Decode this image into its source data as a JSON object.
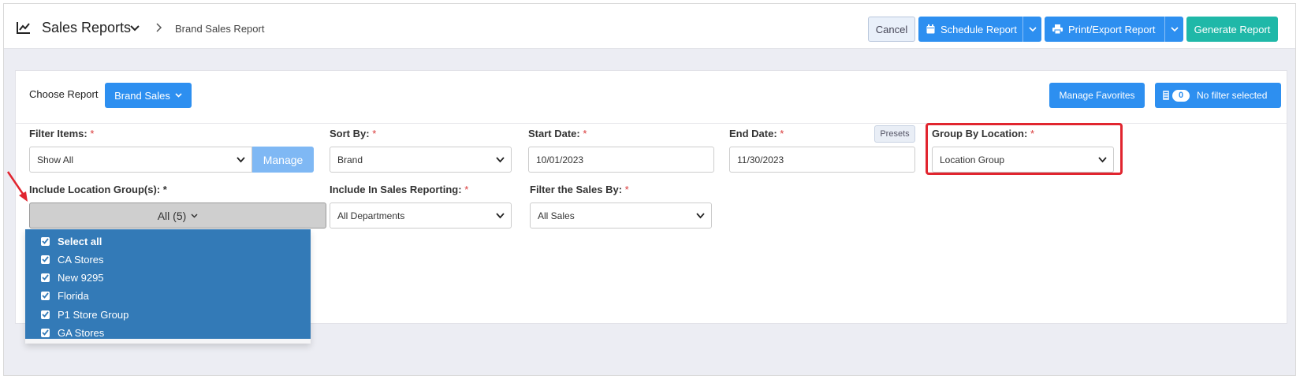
{
  "header": {
    "title": "Sales Reports",
    "breadcrumb": "Brand Sales Report",
    "cancel_label": "Cancel",
    "schedule_label": "Schedule Report",
    "print_label": "Print/Export Report",
    "generate_label": "Generate Report"
  },
  "report": {
    "choose_label": "Choose Report",
    "selected": "Brand Sales",
    "favorites_label": "Manage Favorites",
    "filter_count": "0",
    "filter_status": "No filter selected"
  },
  "filters": {
    "filter_items": {
      "label": "Filter Items:",
      "value": "Show All",
      "manage_label": "Manage"
    },
    "sort_by": {
      "label": "Sort By:",
      "value": "Brand"
    },
    "start_date": {
      "label": "Start Date:",
      "value": "10/01/2023"
    },
    "end_date": {
      "label": "End Date:",
      "value": "11/30/2023",
      "presets_label": "Presets"
    },
    "group_by": {
      "label": "Group By Location:",
      "value": "Location Group"
    },
    "include_location": {
      "label": "Include Location Group(s): *",
      "value": "All (5)"
    },
    "include_sales": {
      "label": "Include In Sales Reporting:",
      "value": "All Departments"
    },
    "filter_sales": {
      "label": "Filter the Sales By:",
      "value": "All Sales"
    },
    "required_mark": "*"
  },
  "location_groups": {
    "options": [
      "Select all",
      "CA Stores",
      "New 9295",
      "Florida",
      "P1 Store Group",
      "GA Stores"
    ],
    "checked": [
      true,
      true,
      true,
      true,
      true,
      true
    ]
  },
  "colors": {
    "primary": "#2d8ff0",
    "generate": "#1fb8a8",
    "dropdown_bg": "#337ab7",
    "highlight": "#e1252f"
  },
  "icons": {
    "title": "line-chart-icon",
    "schedule": "calendar-icon",
    "print": "printer-icon",
    "filter": "filter-icon"
  }
}
